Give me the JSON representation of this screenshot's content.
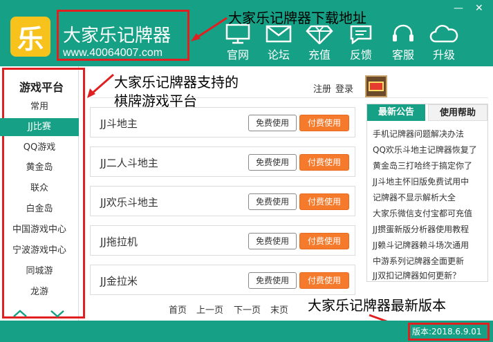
{
  "window": {
    "minimize_glyph": "—",
    "close_glyph": "✕"
  },
  "logo": {
    "glyph": "乐",
    "name": "大家乐记牌器",
    "url": "www.40064007.com"
  },
  "nav": [
    {
      "label": "官网",
      "icon": "monitor-icon"
    },
    {
      "label": "论坛",
      "icon": "mail-icon"
    },
    {
      "label": "充值",
      "icon": "diamond-icon"
    },
    {
      "label": "反馈",
      "icon": "feedback-icon"
    },
    {
      "label": "客服",
      "icon": "headset-icon"
    },
    {
      "label": "升级",
      "icon": "cloud-icon"
    }
  ],
  "annotations": {
    "download": "大家乐记牌器下载地址",
    "platforms_line1": "大家乐记牌器支持的",
    "platforms_line2": "棋牌游戏平台",
    "latest": "大家乐记牌器最新版本"
  },
  "sidebar": {
    "title": "游戏平台",
    "items": [
      "常用",
      "JJ比赛",
      "QQ游戏",
      "黄金岛",
      "联众",
      "白金岛",
      "中国游戏中心",
      "宁波游戏中心",
      "同城游",
      "龙游"
    ],
    "active_index": 1
  },
  "account": {
    "register": "注册",
    "login": "登录"
  },
  "games": [
    {
      "title": "JJ斗地主"
    },
    {
      "title": "JJ二人斗地主"
    },
    {
      "title": "JJ欢乐斗地主"
    },
    {
      "title": "JJ拖拉机"
    },
    {
      "title": "JJ金拉米"
    }
  ],
  "buttons": {
    "free": "免费使用",
    "paid": "付费使用"
  },
  "pager": {
    "first": "首页",
    "prev": "上一页",
    "next": "下一页",
    "last": "末页"
  },
  "right_panel": {
    "tabs": [
      "最新公告",
      "使用帮助"
    ],
    "news": [
      "手机记牌器问题解决办法",
      "QQ欢乐斗地主记牌器恢复了",
      "黄金岛三打哈终于搞定你了",
      "JJ斗地主怀旧版免费试用中",
      "记牌器不显示解析大全",
      "大家乐微信支付宝都可充值",
      "JJ掼蛋新版分析器使用教程",
      "JJ赖斗记牌器赖斗场次通用",
      "中游系列记牌器全面更新",
      "JJ双扣记牌器如何更新？"
    ]
  },
  "version": "版本:2018.6.9.01",
  "colors": {
    "primary": "#16a085",
    "accent": "#f57a2c",
    "highlight": "#e02020",
    "logo": "#f7c21b"
  }
}
